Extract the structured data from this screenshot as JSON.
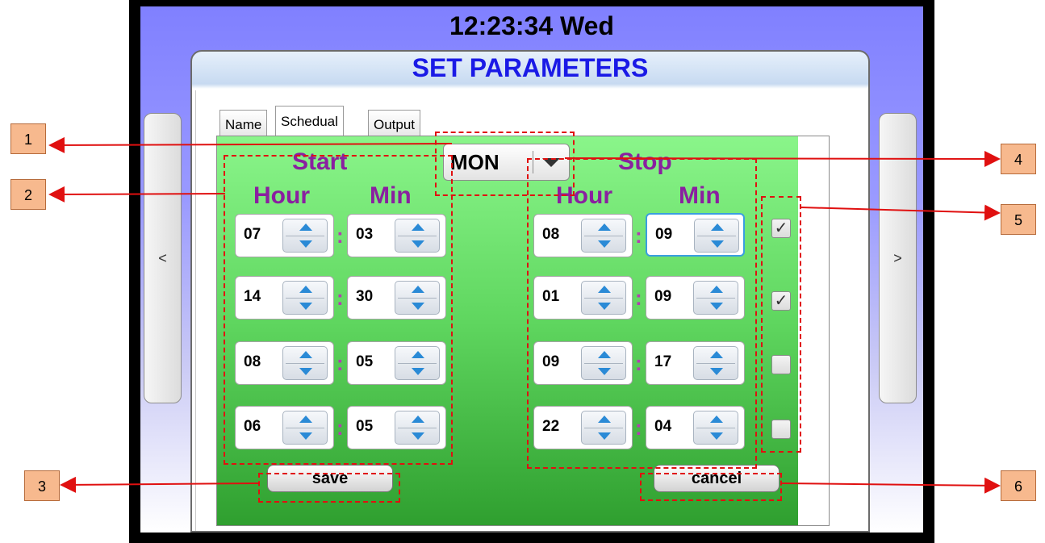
{
  "clock": "12:23:34 Wed",
  "window_title": "SET PARAMETERS",
  "nav": {
    "prev_label": "<",
    "next_label": ">"
  },
  "tabs": [
    {
      "label": "Name",
      "active": false
    },
    {
      "label": "Schedual",
      "active": true
    },
    {
      "label": "Output",
      "active": false
    }
  ],
  "day_selector": {
    "value": "MON"
  },
  "start": {
    "heading": "Start",
    "hour_label": "Hour",
    "min_label": "Min",
    "rows": [
      {
        "hour": "07",
        "min": "03"
      },
      {
        "hour": "14",
        "min": "30"
      },
      {
        "hour": "08",
        "min": "05"
      },
      {
        "hour": "06",
        "min": "05"
      }
    ]
  },
  "stop": {
    "heading": "Stop",
    "hour_label": "Hour",
    "min_label": "Min",
    "rows": [
      {
        "hour": "08",
        "min": "09"
      },
      {
        "hour": "01",
        "min": "09"
      },
      {
        "hour": "09",
        "min": "17"
      },
      {
        "hour": "22",
        "min": "04"
      }
    ]
  },
  "enabled": [
    true,
    true,
    false,
    false
  ],
  "colon": ":",
  "save_label": "save",
  "cancel_label": "cancel",
  "checkmark": "✓",
  "callouts": [
    "1",
    "2",
    "3",
    "4",
    "5",
    "6"
  ],
  "colors": {
    "title_blue": "#1a1ae6",
    "heading_purple": "#8a1fa0",
    "annotation_red": "#e01010",
    "callout_fill": "#f7b98e",
    "panel_green": "#5fd65f"
  }
}
